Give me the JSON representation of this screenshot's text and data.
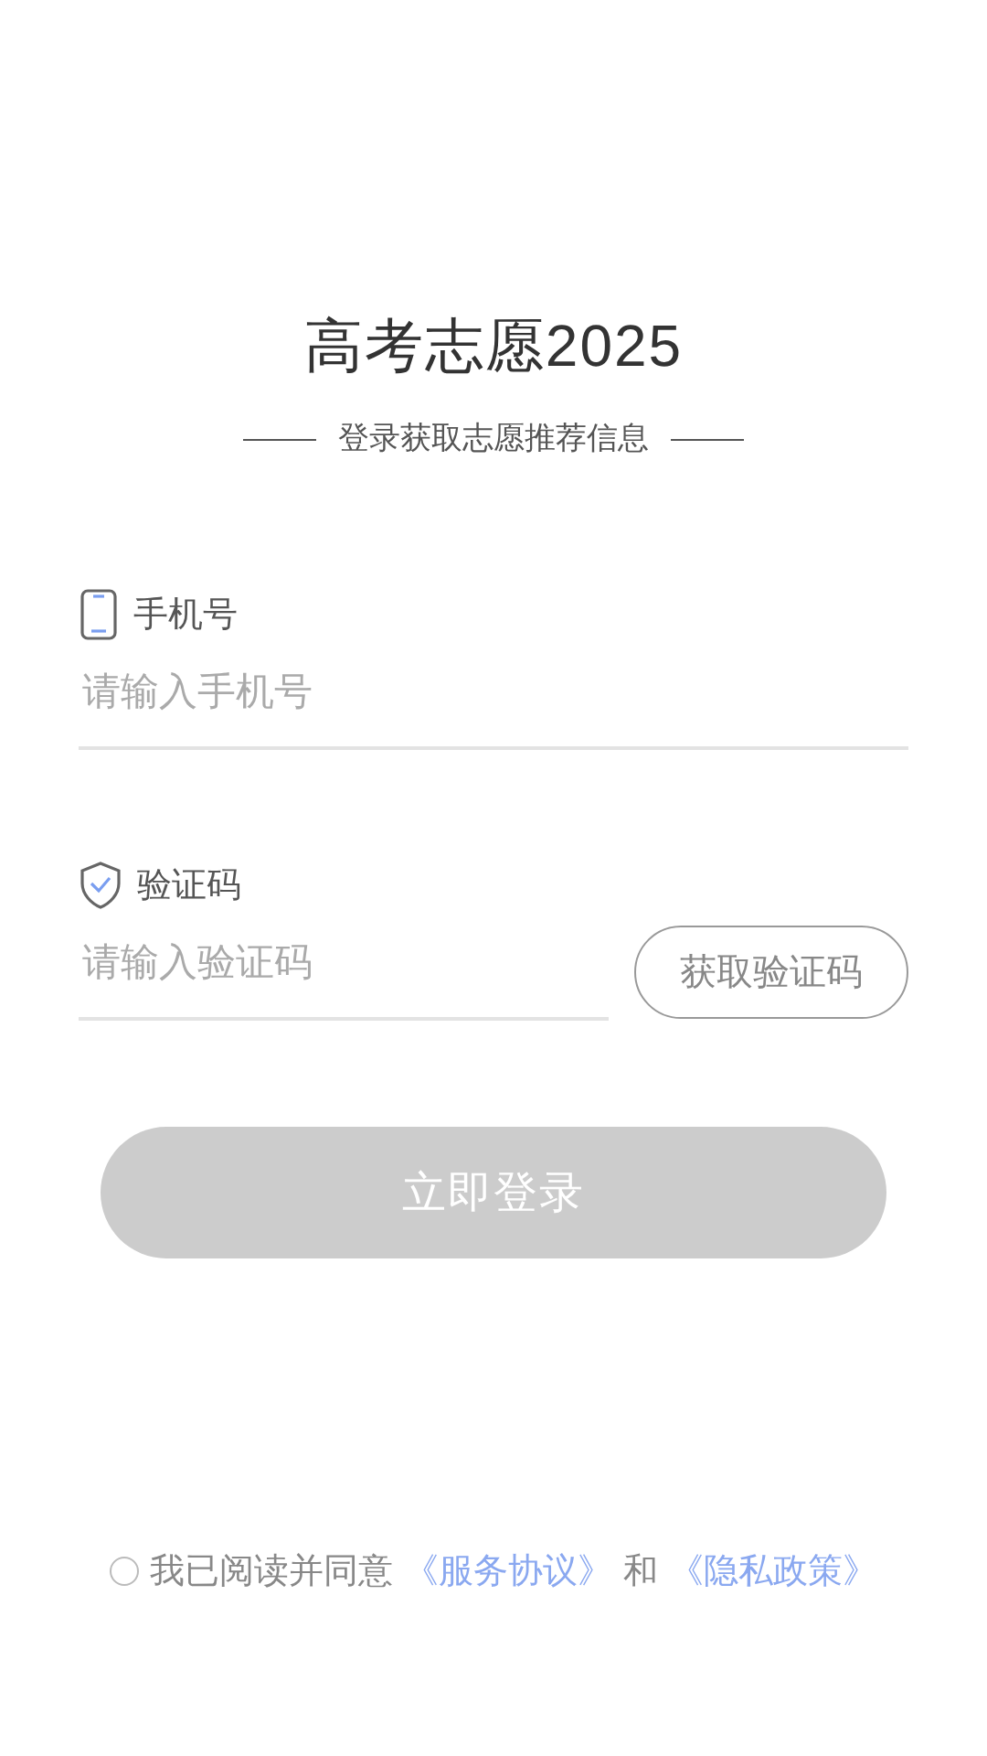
{
  "title": "高考志愿2025",
  "subtitle": "登录获取志愿推荐信息",
  "phone": {
    "label": "手机号",
    "placeholder": "请输入手机号"
  },
  "code": {
    "label": "验证码",
    "placeholder": "请输入验证码",
    "button": "获取验证码"
  },
  "login_button": {
    "label": "立即登录",
    "disabled": true
  },
  "agreement": {
    "checked": false,
    "text": "我已阅读并同意",
    "links": [
      "《服务协议》",
      "《隐私政策》"
    ],
    "joiner": "和"
  }
}
